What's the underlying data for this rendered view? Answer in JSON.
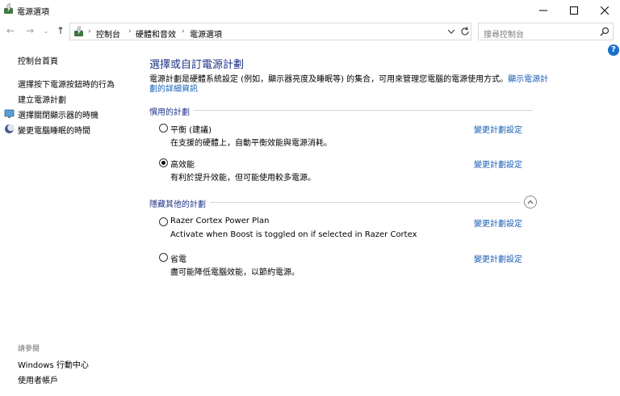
{
  "window": {
    "title": "電源選項"
  },
  "address": {
    "crumbs": [
      "控制台",
      "硬體和音效",
      "電源選項"
    ]
  },
  "search": {
    "placeholder": "搜尋控制台"
  },
  "sidebar": {
    "home": "控制台首頁",
    "links": [
      {
        "label": "選擇按下電源按鈕時的行為",
        "icon": "none"
      },
      {
        "label": "建立電源計劃",
        "icon": "none"
      },
      {
        "label": "選擇關閉顯示器的時機",
        "icon": "monitor-icon"
      },
      {
        "label": "變更電腦睡眠的時間",
        "icon": "moon-icon"
      }
    ],
    "see_also": "請參閱",
    "see_also_links": [
      "Windows 行動中心",
      "使用者帳戶"
    ]
  },
  "main": {
    "title": "選擇或自訂電源計劃",
    "description": "電源計劃是硬體系統設定 (例如，顯示器亮度及睡眠等) 的集合，可用來管理您電腦的電源使用方式。",
    "description_link": "顯示電源計劃的詳細資訊",
    "preferred_header": "慣用的計劃",
    "hidden_header": "隱藏其他的計劃",
    "change_label": "變更計劃設定",
    "plans": [
      {
        "name": "平衡 (建議)",
        "desc": "在支援的硬體上，自動平衡效能與電源消耗。",
        "selected": false
      },
      {
        "name": "高效能",
        "desc": "有利於提升效能，但可能使用較多電源。",
        "selected": true
      },
      {
        "name": "Razer Cortex Power Plan",
        "desc": "Activate when Boost is toggled on if selected in Razer Cortex",
        "selected": false
      },
      {
        "name": "省電",
        "desc": "盡可能降低電腦效能，以節約電源。",
        "selected": false
      }
    ]
  },
  "help": {
    "label": "?"
  },
  "colors": {
    "accent": "#1e3287",
    "link": "#1a5fb4",
    "help": "#1a6fcd"
  }
}
